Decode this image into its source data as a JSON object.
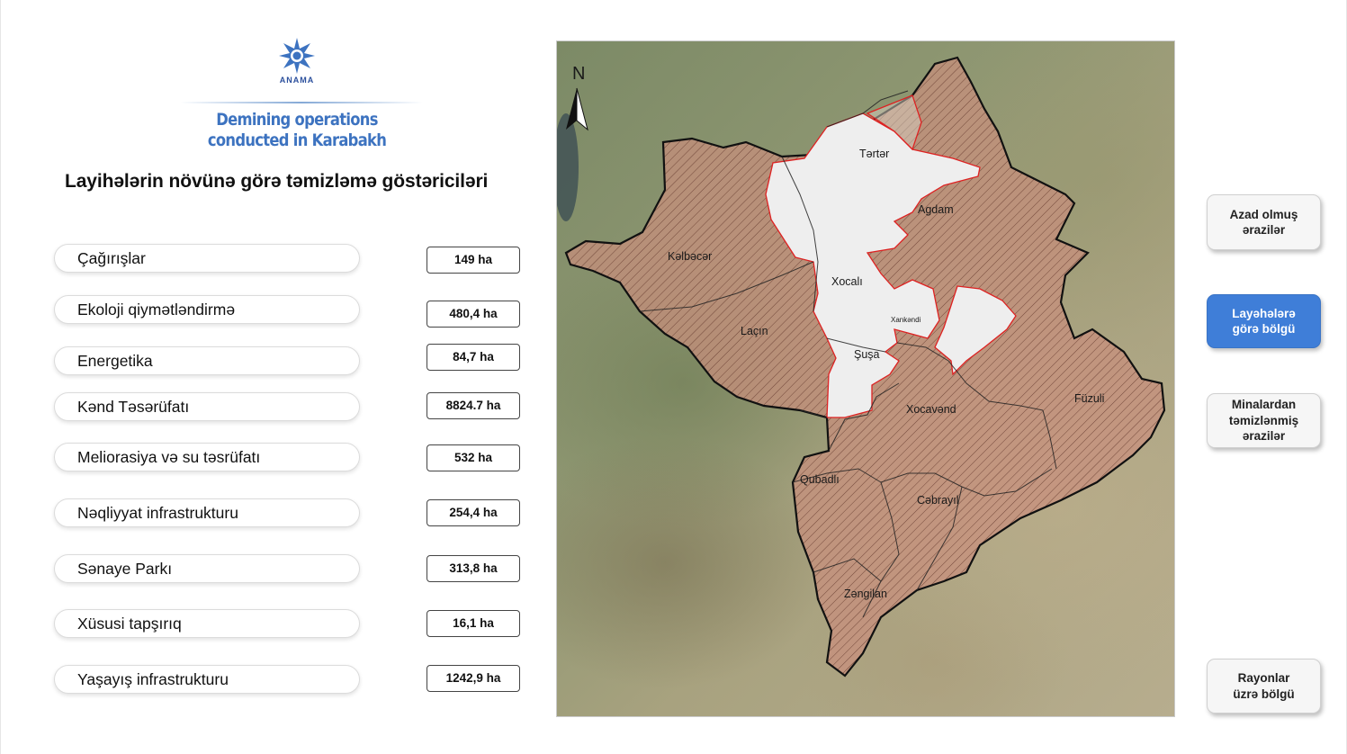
{
  "header": {
    "logo_text": "ANAMA",
    "title_line1": "Demining operations",
    "title_line2": "conducted in Karabakh"
  },
  "heading": "Layihələrin növünə görə təmizləmə göstəriciləri",
  "rows": [
    {
      "label": "Çağırışlar",
      "value": "149 ha"
    },
    {
      "label": "Ekoloji qiymətləndirmə",
      "value": "480,4 ha"
    },
    {
      "label": "Energetika",
      "value": "84,7 ha"
    },
    {
      "label": "Kənd Təsərüfatı",
      "value": "8824.7 ha"
    },
    {
      "label": "Meliorasiya və su təsrüfatı",
      "value": "532 ha"
    },
    {
      "label": "Nəqliyyat infrastrukturu",
      "value": "254,4 ha"
    },
    {
      "label": "Sənaye Parkı",
      "value": "313,8 ha"
    },
    {
      "label": "Xüsusi tapşırıq",
      "value": "16,1 ha"
    },
    {
      "label": "Yaşayış infrastrukturu",
      "value": "1242,9 ha"
    }
  ],
  "map": {
    "north_label": "N",
    "regions": {
      "terter": "Tərtər",
      "agdam": "Agdam",
      "kelbecer": "Kəlbəcər",
      "xocali": "Xocalı",
      "xankendi": "Xankəndi",
      "lacin": "Laçın",
      "susa": "Şuşa",
      "xocavend": "Xocavənd",
      "fuzuli": "Füzuli",
      "qubadli": "Qubadlı",
      "cebrayil": "Cəbrayıl",
      "zengilan": "Zəngilan"
    }
  },
  "side_buttons": [
    {
      "label": "Azad olmuş\nərazilər",
      "active": false
    },
    {
      "label": "Layəhələrə\ngörə bölgü",
      "active": true
    },
    {
      "label": "Minalardan\ntəmizlənmiş\nərazilər",
      "active": false
    },
    {
      "label": "Rayonlar\nüzrə bölgü",
      "active": false
    }
  ],
  "colors": {
    "accent_blue": "#3f7ed8",
    "title_blue": "#3d73c0",
    "hatch_fill": "#c98f7d",
    "freed_fill": "#eeeeee"
  }
}
